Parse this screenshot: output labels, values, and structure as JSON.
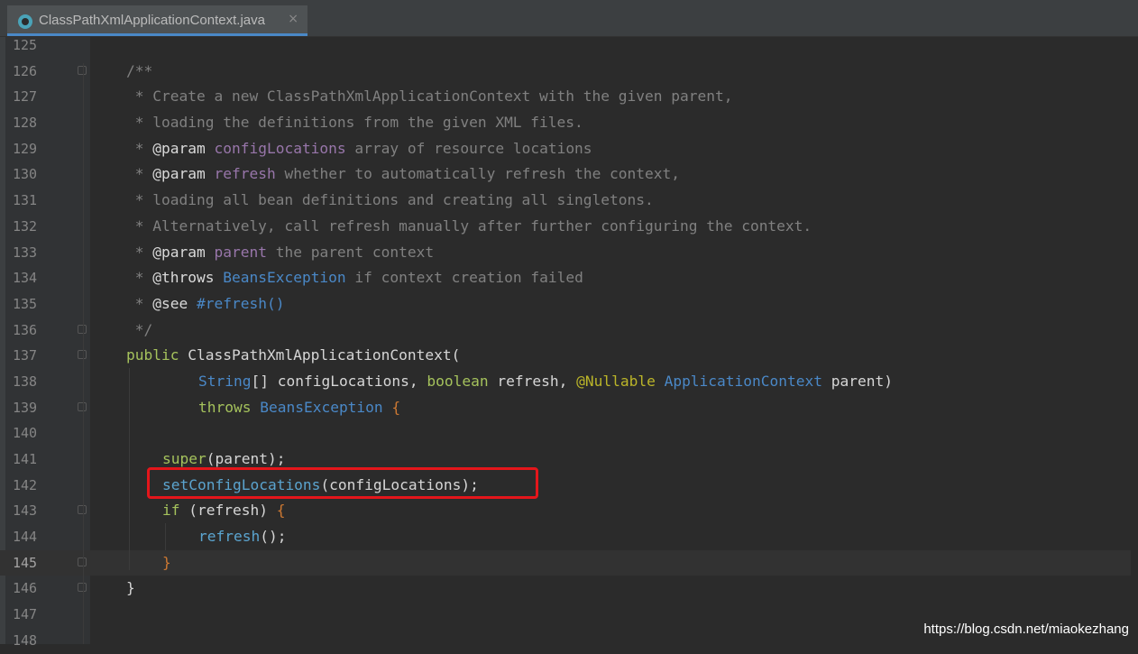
{
  "tab": {
    "title": "ClassPathXmlApplicationContext.java",
    "close_glyph": "×",
    "icon": "java-class-icon"
  },
  "colors": {
    "background": "#2b2b2b",
    "highlight_box": "#e4161b"
  },
  "lines": [
    {
      "no": "125"
    },
    {
      "no": "126",
      "fold": true,
      "doc": "/**"
    },
    {
      "no": "127",
      "doc": " * Create a new ClassPathXmlApplicationContext with the given parent,"
    },
    {
      "no": "128",
      "doc": " * loading the definitions from the given XML files."
    },
    {
      "no": "129",
      "pre": " * ",
      "tag": "@param",
      "param": "configLocations",
      "rest": " array of resource locations"
    },
    {
      "no": "130",
      "pre": " * ",
      "tag": "@param",
      "param": "refresh",
      "rest": " whether to automatically refresh the context,"
    },
    {
      "no": "131",
      "doc": " * loading all bean definitions and creating all singletons."
    },
    {
      "no": "132",
      "doc": " * Alternatively, call refresh manually after further configuring the context."
    },
    {
      "no": "133",
      "pre": " * ",
      "tag": "@param",
      "param": "parent",
      "rest": " the parent context"
    },
    {
      "no": "134",
      "pre": " * ",
      "tag": "@throws",
      "ref": "BeansException",
      "rest": " if context creation failed"
    },
    {
      "no": "135",
      "pre": " * ",
      "tag": "@see",
      "ref": "#refresh()"
    },
    {
      "no": "136",
      "fold": true,
      "doc": " */"
    },
    {
      "no": "137",
      "fold": true,
      "k1": "public",
      "p1": " ClassPathXmlApplicationContext("
    },
    {
      "no": "138",
      "t1": "String",
      "p1": "[] configLocations, ",
      "k1": "boolean",
      "p2": " refresh, ",
      "a1": "@Nullable",
      "t2": " ApplicationContext",
      "p3": " parent)"
    },
    {
      "no": "139",
      "fold": true,
      "k1": "throws",
      "t1": " BeansException",
      "b1": " {"
    },
    {
      "no": "140"
    },
    {
      "no": "141",
      "k1": "super",
      "p1": "(parent);"
    },
    {
      "no": "142",
      "m1": "setConfigLocations",
      "p1": "(configLocations);"
    },
    {
      "no": "143",
      "fold": true,
      "k1": "if",
      "p1": " (refresh) ",
      "b1": "{"
    },
    {
      "no": "144",
      "m1": "refresh",
      "p1": "();"
    },
    {
      "no": "145",
      "fold": true,
      "b1": "}"
    },
    {
      "no": "146",
      "fold": true,
      "p1": "}"
    },
    {
      "no": "147"
    },
    {
      "no": "148"
    }
  ],
  "watermark": "https://blog.csdn.net/miaokezhang"
}
